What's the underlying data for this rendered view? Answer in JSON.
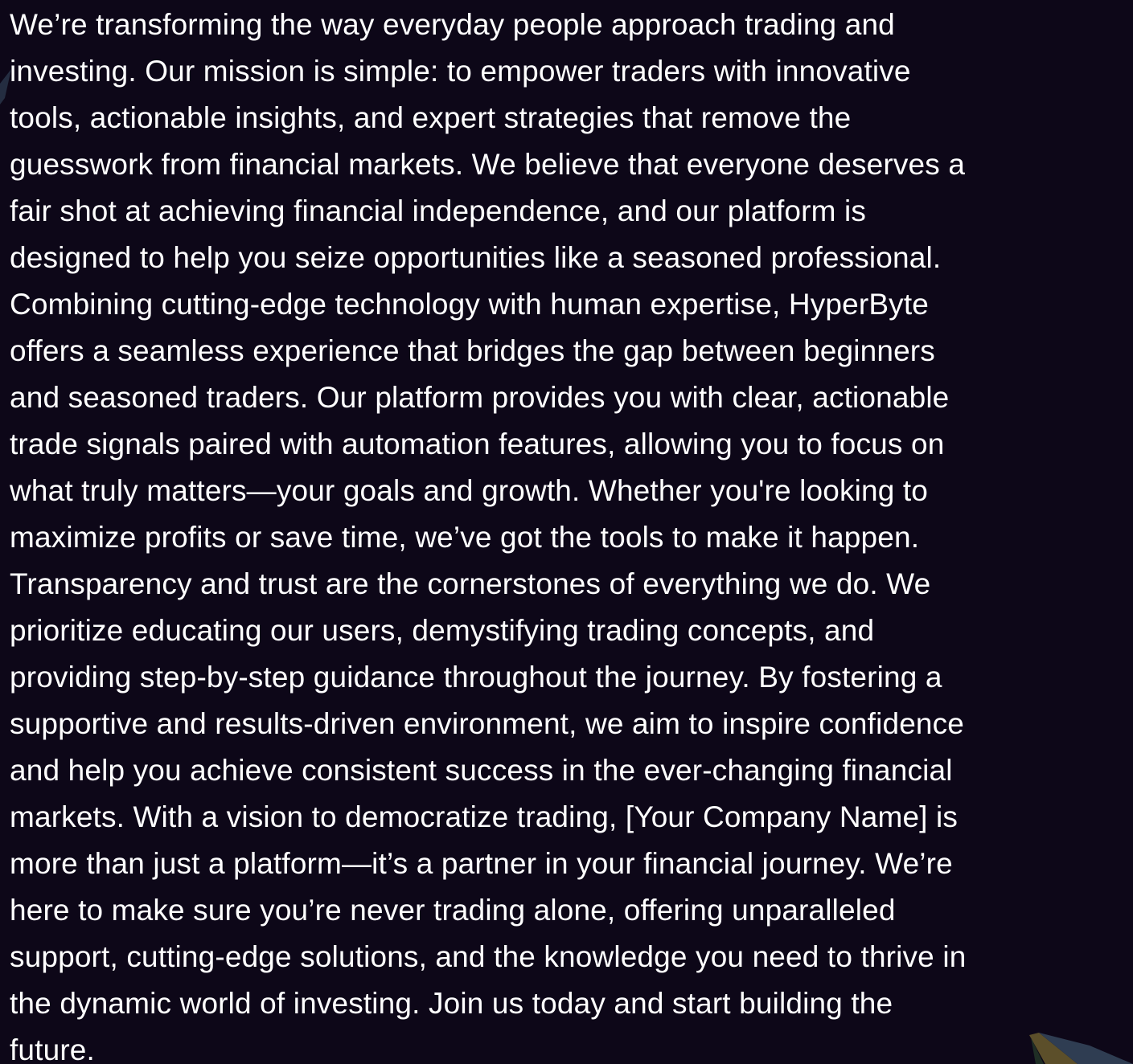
{
  "about": {
    "lines": [
      "We’re transforming the way everyday people approach trading and",
      "investing. Our mission is simple: to empower traders with innovative",
      "tools, actionable insights, and expert strategies that remove the",
      "guesswork from financial markets. We believe that everyone deserves a",
      "fair shot at achieving financial independence, and our platform is",
      "designed to help you seize opportunities like a seasoned professional.",
      "Combining cutting-edge technology with human expertise, HyperByte",
      "offers a seamless experience that bridges the gap between beginners",
      "and seasoned traders. Our platform provides you with clear, actionable",
      "trade signals paired with automation features, allowing you to focus on",
      "what truly matters—your goals and growth. Whether you're looking to",
      "maximize profits or save time, we’ve got the tools to make it happen.",
      "Transparency and trust are the cornerstones of everything we do. We",
      "prioritize educating our users, demystifying trading concepts, and",
      "providing step-by-step guidance throughout the journey. By fostering a",
      "supportive and results-driven environment, we aim to inspire confidence",
      "and help you achieve consistent success in the ever-changing financial",
      "markets. With a vision to democratize trading, [Your Company Name] is",
      "more than just a platform—it’s a partner in your financial journey. We’re",
      "here to make sure you’re never trading alone, offering unparalleled",
      "support, cutting-edge solutions, and the knowledge you need to thrive in",
      "the dynamic world of investing. Join us today and start building the",
      "future."
    ]
  },
  "theme": {
    "background": "#0d0718",
    "text_color": "#ffffff",
    "shard_colors": [
      "#5c4f2a",
      "#2f3d52",
      "#1f2e25"
    ]
  }
}
